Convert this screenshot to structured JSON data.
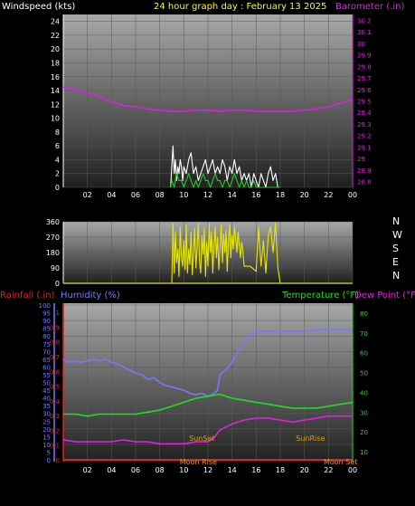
{
  "colors": {
    "background": "#000000",
    "title": "#ffff00",
    "barometer": "#dd22dd",
    "wind_gust": "#ffffff",
    "wind_speed": "#22cc22",
    "wind_direction": "#e6e600",
    "rainfall": "#dd2222",
    "humidity": "#7777ff",
    "temperature": "#22dd22",
    "dewpoint": "#dd22dd",
    "sun_label": "#d8a000",
    "moon_label": "#d8a000"
  },
  "chart_data": [
    {
      "type": "line",
      "id": "wind-barometer",
      "title": "24 hour graph day : February 13 2025",
      "left_axis_label": "Windspeed (kts)",
      "right_axis_label": "Barometer (.in)",
      "x_ticks": [
        "02",
        "04",
        "06",
        "08",
        "10",
        "12",
        "14",
        "16",
        "18",
        "20",
        "22",
        "00"
      ],
      "x_range": [
        0,
        24
      ],
      "y_left_range": [
        0,
        25
      ],
      "y_left_ticks": [
        0,
        2,
        4,
        6,
        8,
        10,
        12,
        14,
        16,
        18,
        20,
        22,
        24
      ],
      "y_right_range": [
        28.75,
        30.25
      ],
      "y_right_ticks": [
        "28.8",
        "28.9",
        "29",
        "29.1",
        "29.2",
        "29.3",
        "29.4",
        "29.5",
        "29.6",
        "29.7",
        "29.8",
        "29.9",
        "30",
        "30.1",
        "30.2"
      ],
      "grid": true,
      "series": [
        {
          "key": "barometer",
          "axis": "right",
          "x": [
            0,
            1,
            2,
            3,
            4,
            5,
            6,
            7,
            8,
            9,
            10,
            11,
            12,
            13,
            14,
            15,
            16,
            17,
            18,
            19,
            20,
            21,
            22,
            23,
            24
          ],
          "y": [
            29.62,
            29.6,
            29.57,
            29.54,
            29.49,
            29.46,
            29.45,
            29.43,
            29.42,
            29.41,
            29.41,
            29.42,
            29.42,
            29.41,
            29.42,
            29.42,
            29.41,
            29.41,
            29.41,
            29.41,
            29.42,
            29.43,
            29.45,
            29.48,
            29.51
          ]
        },
        {
          "key": "wind_gust",
          "axis": "left",
          "x": [
            8.9,
            9.0,
            9.1,
            9.2,
            9.3,
            9.4,
            9.5,
            9.6,
            9.7,
            9.8,
            9.9,
            10.0,
            10.2,
            10.4,
            10.6,
            10.8,
            11.0,
            11.2,
            11.4,
            11.6,
            11.8,
            12.0,
            12.2,
            12.4,
            12.6,
            12.8,
            13.0,
            13.2,
            13.4,
            13.6,
            13.8,
            14.0,
            14.2,
            14.4,
            14.6,
            14.8,
            15.0,
            15.2,
            15.4,
            15.6,
            15.8,
            16.0,
            16.2,
            16.4,
            16.6,
            16.8,
            17.0,
            17.2,
            17.4,
            17.6,
            17.8,
            18.0
          ],
          "y": [
            0,
            3,
            6,
            2,
            4,
            1,
            3,
            2,
            4,
            3,
            1,
            3,
            2,
            4,
            5,
            2,
            3,
            1,
            2,
            3,
            4,
            2,
            3,
            4,
            2,
            3,
            2,
            4,
            3,
            1,
            3,
            2,
            4,
            2,
            3,
            1,
            2,
            1,
            2,
            0,
            2,
            1,
            0,
            2,
            1,
            0,
            2,
            3,
            1,
            2,
            0,
            0
          ]
        },
        {
          "key": "wind_speed",
          "axis": "left",
          "x": [
            8.9,
            9.0,
            9.2,
            9.4,
            9.6,
            9.8,
            10.0,
            10.2,
            10.4,
            10.6,
            10.8,
            11.0,
            11.2,
            11.4,
            11.6,
            11.8,
            12.0,
            12.2,
            12.4,
            12.6,
            12.8,
            13.0,
            13.2,
            13.4,
            13.6,
            13.8,
            14.0,
            14.2,
            14.4,
            14.6,
            14.8,
            15.0,
            15.2,
            15.4,
            15.6,
            15.8,
            16.0,
            16.5,
            17.0,
            17.5,
            18.0
          ],
          "y": [
            0,
            1,
            0,
            2,
            1,
            1,
            0,
            1,
            2,
            1,
            0,
            1,
            0,
            1,
            2,
            1,
            1,
            0,
            1,
            2,
            1,
            1,
            0,
            1,
            1,
            0,
            1,
            2,
            1,
            0,
            1,
            0,
            1,
            0,
            0,
            1,
            0,
            0,
            0,
            0,
            0
          ]
        }
      ]
    },
    {
      "type": "line",
      "id": "wind-direction",
      "x_range": [
        0,
        24
      ],
      "y_range": [
        0,
        360
      ],
      "y_ticks": [
        0,
        90,
        180,
        270,
        360
      ],
      "right_labels": [
        "N",
        "W",
        "S",
        "E",
        "N"
      ],
      "grid": true,
      "series": [
        {
          "key": "wind_direction",
          "x": [
            9.0,
            9.1,
            9.2,
            9.3,
            9.4,
            9.5,
            9.6,
            9.7,
            9.8,
            9.9,
            10.0,
            10.1,
            10.2,
            10.3,
            10.4,
            10.5,
            10.6,
            10.7,
            10.8,
            10.9,
            11.0,
            11.1,
            11.2,
            11.3,
            11.4,
            11.5,
            11.6,
            11.7,
            11.8,
            11.9,
            12.0,
            12.1,
            12.2,
            12.3,
            12.4,
            12.5,
            12.6,
            12.7,
            12.8,
            12.9,
            13.0,
            13.1,
            13.2,
            13.3,
            13.4,
            13.5,
            13.6,
            13.7,
            13.8,
            13.9,
            14.0,
            14.1,
            14.2,
            14.3,
            14.4,
            14.5,
            14.6,
            14.7,
            14.8,
            14.9,
            15.0,
            15.5,
            16.0,
            16.2,
            16.4,
            16.6,
            16.8,
            17.0,
            17.2,
            17.4,
            17.6,
            17.8,
            18.0
          ],
          "y": [
            0,
            350,
            60,
            300,
            120,
            200,
            40,
            330,
            150,
            100,
            250,
            80,
            340,
            60,
            200,
            110,
            300,
            50,
            180,
            320,
            90,
            210,
            350,
            130,
            60,
            280,
            170,
            320,
            40,
            240,
            100,
            350,
            180,
            300,
            60,
            220,
            330,
            150,
            270,
            80,
            200,
            340,
            120,
            290,
            180,
            310,
            70,
            250,
            340,
            150,
            280,
            200,
            330,
            260,
            180,
            300,
            220,
            150,
            240,
            190,
            100,
            100,
            70,
            330,
            100,
            250,
            60,
            280,
            330,
            180,
            350,
            90,
            0
          ]
        }
      ]
    },
    {
      "type": "line",
      "id": "rain-humidity-temp",
      "left_axis_label_1": "Rainfall (.in)",
      "left_axis_label_2": "Humidity (%)",
      "right_axis_label_1": "Temperature (°F)",
      "right_axis_label_2": "Dew Point (°F)",
      "x_ticks": [
        "02",
        "04",
        "06",
        "08",
        "10",
        "12",
        "14",
        "16",
        "18",
        "20",
        "22",
        "00"
      ],
      "x_range": [
        0,
        24
      ],
      "humidity_range": [
        0,
        100
      ],
      "humidity_ticks": [
        0,
        5,
        10,
        15,
        20,
        25,
        30,
        35,
        40,
        45,
        50,
        55,
        60,
        65,
        70,
        75,
        80,
        85,
        90,
        95,
        100
      ],
      "rain_range": [
        0,
        1.05
      ],
      "rain_ticks": [
        "0",
        "0.1",
        "0.2",
        "0.3",
        "0.4",
        "0.5",
        "0.6",
        "0.7",
        "0.8",
        "0.9",
        "1"
      ],
      "temp_range": [
        5,
        85
      ],
      "temp_ticks": [
        10,
        20,
        30,
        40,
        50,
        60,
        70,
        80
      ],
      "grid": true,
      "series": [
        {
          "key": "humidity",
          "x": [
            0,
            0.5,
            1,
            1.5,
            2,
            2.5,
            3,
            3.5,
            4,
            4.5,
            5,
            5.5,
            6,
            6.5,
            7,
            7.5,
            8,
            8.5,
            9,
            9.5,
            10,
            10.5,
            11,
            11.5,
            12,
            12.5,
            12.8,
            13,
            13.5,
            14,
            14.5,
            15,
            15.5,
            16,
            16.5,
            17,
            18,
            19,
            20,
            21,
            22,
            23,
            24
          ],
          "y": [
            65,
            63,
            64,
            63,
            64,
            65,
            64,
            65,
            63,
            62,
            60,
            58,
            56,
            55,
            52,
            53,
            50,
            48,
            47,
            46,
            45,
            43,
            42,
            43,
            41,
            43,
            45,
            55,
            58,
            63,
            70,
            76,
            80,
            83,
            83,
            83,
            83,
            83,
            83,
            84,
            84,
            84,
            84
          ]
        },
        {
          "key": "temperature",
          "x": [
            0,
            1,
            2,
            3,
            4,
            5,
            6,
            7,
            8,
            9,
            10,
            11,
            12,
            13,
            14,
            15,
            16,
            17,
            18,
            19,
            20,
            21,
            22,
            23,
            24
          ],
          "y": [
            29,
            29,
            28,
            29,
            29,
            29,
            29,
            30,
            31,
            33,
            35,
            37,
            38,
            39,
            37,
            36,
            35,
            34,
            33,
            32,
            32,
            32,
            33,
            34,
            35
          ]
        },
        {
          "key": "dewpoint",
          "x": [
            0,
            1,
            2,
            3,
            4,
            5,
            6,
            7,
            8,
            9,
            10,
            11,
            12,
            12.5,
            13,
            14,
            15,
            16,
            17,
            18,
            19,
            20,
            21,
            22,
            23,
            24
          ],
          "y": [
            16,
            15,
            15,
            15,
            15,
            16,
            15,
            15,
            14,
            14,
            14,
            15,
            15,
            17,
            21,
            24,
            26,
            27,
            27,
            26,
            25,
            26,
            27,
            28,
            28,
            28
          ]
        },
        {
          "key": "rainfall",
          "x": [
            0,
            24
          ],
          "y": [
            0,
            0
          ]
        }
      ],
      "annotations": [
        {
          "text": "SunSet",
          "x": 11.5,
          "level": 17,
          "color_key": "sun_label"
        },
        {
          "text": "SunRise",
          "x": 20.5,
          "level": 17,
          "color_key": "sun_label"
        },
        {
          "text": "Moon Rise",
          "x": 11.2,
          "level": 5,
          "color_key": "moon_label"
        },
        {
          "text": "Moon Set",
          "x": 23.0,
          "level": 5,
          "color_key": "moon_label"
        }
      ]
    }
  ]
}
